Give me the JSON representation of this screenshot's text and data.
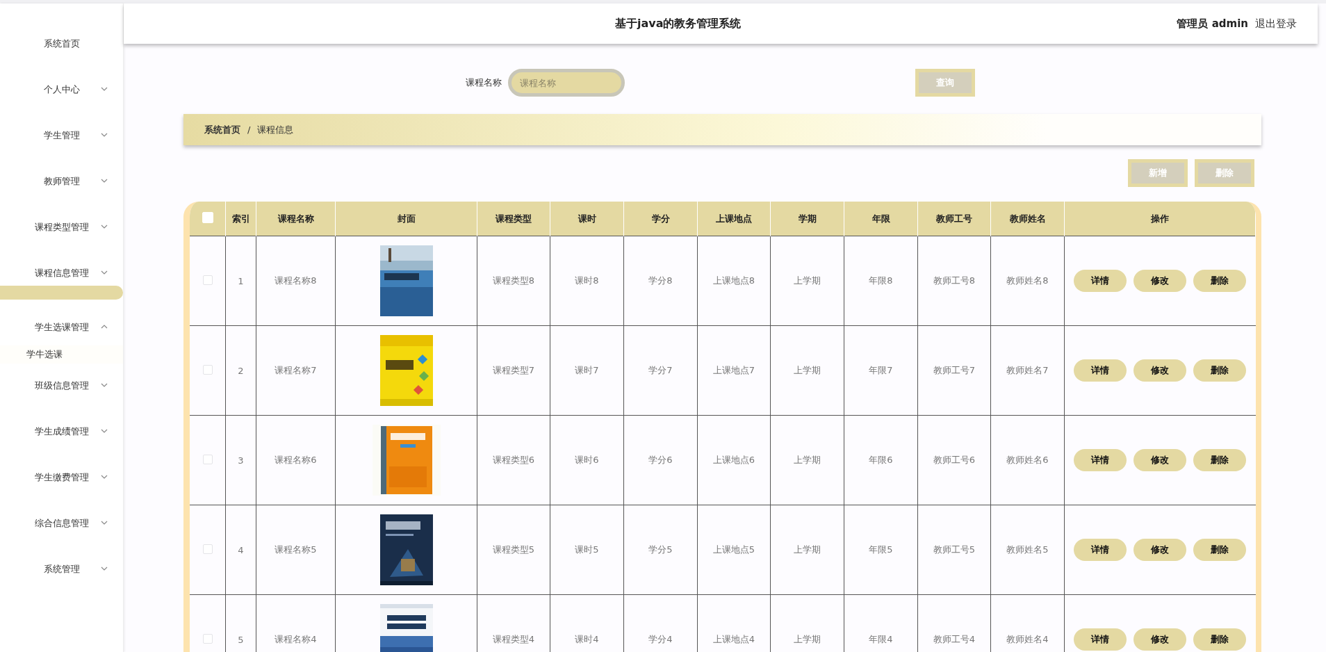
{
  "header": {
    "title": "基于java的教务管理系统",
    "user": "管理员 admin",
    "logout": "退出登录"
  },
  "sidebar": {
    "items": [
      {
        "label": "系统首页",
        "has_arrow": false,
        "selected": false
      },
      {
        "label": "个人中心",
        "has_arrow": true,
        "selected": false
      },
      {
        "label": "学生管理",
        "has_arrow": true,
        "selected": false
      },
      {
        "label": "教师管理",
        "has_arrow": true,
        "selected": false
      },
      {
        "label": "课程类型管理",
        "has_arrow": true,
        "selected": false
      },
      {
        "label": "课程信息管理",
        "has_arrow": true,
        "selected": true
      },
      {
        "label": "学生选课管理",
        "has_arrow": true,
        "selected": false,
        "children": [
          {
            "label": "学牛选课"
          }
        ]
      },
      {
        "label": "班级信息管理",
        "has_arrow": true,
        "selected": false
      },
      {
        "label": "学生成绩管理",
        "has_arrow": true,
        "selected": false
      },
      {
        "label": "学生缴费管理",
        "has_arrow": true,
        "selected": false
      },
      {
        "label": "综合信息管理",
        "has_arrow": true,
        "selected": false
      },
      {
        "label": "系统管理",
        "has_arrow": true,
        "selected": false
      }
    ]
  },
  "search": {
    "label": "课程名称",
    "placeholder": "课程名称",
    "button": "查询"
  },
  "breadcrumb": [
    "系统首页",
    "课程信息"
  ],
  "breadcrumb_separator": "/",
  "actions": [
    "新增",
    "删除"
  ],
  "table": {
    "header_checked": false,
    "columns": [
      "索引",
      "课程名称",
      "封面",
      "课程类型",
      "课时",
      "学分",
      "上课地点",
      "学期",
      "年限",
      "教师工号",
      "教师姓名",
      "操作"
    ],
    "rows": [
      {
        "checked": false,
        "cells": [
          "1",
          "课程名称8",
          {
            "kind": "picture"
          },
          "课程类型8",
          "课时8",
          "学分8",
          "上课地点8",
          "上学期",
          "年限8",
          "教师工号8",
          "教师姓名8"
        ],
        "buttons": [
          "详情",
          "修改",
          "删除"
        ]
      },
      {
        "checked": false,
        "cells": [
          "2",
          "课程名称7",
          {
            "kind": "picture"
          },
          "课程类型7",
          "课时7",
          "学分7",
          "上课地点7",
          "上学期",
          "年限7",
          "教师工号7",
          "教师姓名7"
        ],
        "buttons": [
          "详情",
          "修改",
          "删除"
        ]
      },
      {
        "checked": false,
        "cells": [
          "3",
          "课程名称6",
          {
            "kind": "picture"
          },
          "课程类型6",
          "课时6",
          "学分6",
          "上课地点6",
          "上学期",
          "年限6",
          "教师工号6",
          "教师姓名6"
        ],
        "buttons": [
          "详情",
          "修改",
          "删除"
        ]
      },
      {
        "checked": false,
        "cells": [
          "4",
          "课程名称5",
          {
            "kind": "picture"
          },
          "课程类型5",
          "课时5",
          "学分5",
          "上课地点5",
          "上学期",
          "年限5",
          "教师工号5",
          "教师姓名5"
        ],
        "buttons": [
          "详情",
          "修改",
          "删除"
        ]
      },
      {
        "checked": false,
        "cells": [
          "5",
          "课程名称4",
          {
            "kind": "picture"
          },
          "课程类型4",
          "课时4",
          "学分4",
          "上课地点4",
          "上学期",
          "年限4",
          "教师工号4",
          "教师姓名4"
        ],
        "buttons": [
          "详情",
          "修改",
          "删除"
        ]
      }
    ]
  }
}
